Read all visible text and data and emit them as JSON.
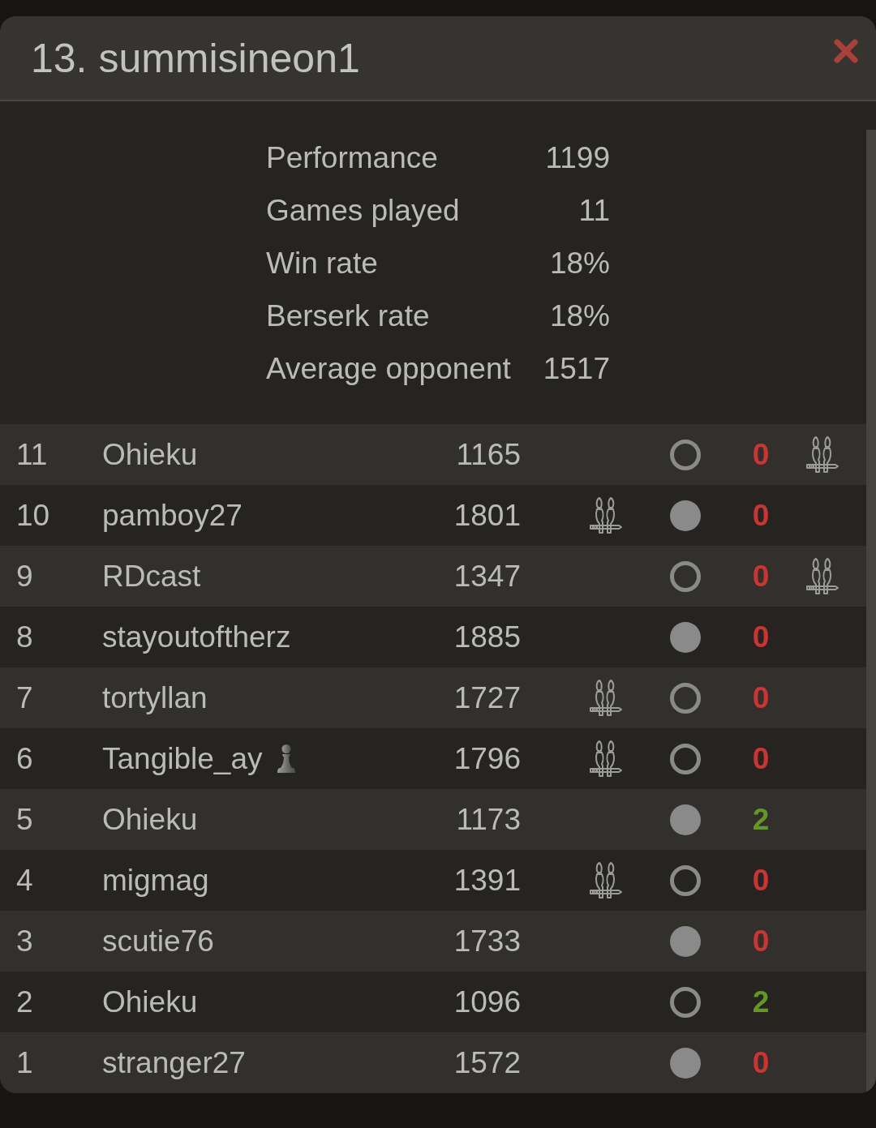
{
  "dialog": {
    "title": "13. summisineon1"
  },
  "stats": [
    {
      "label": "Performance",
      "value": "1199"
    },
    {
      "label": "Games played",
      "value": "11"
    },
    {
      "label": "Win rate",
      "value": "18%"
    },
    {
      "label": "Berserk rate",
      "value": "18%"
    },
    {
      "label": "Average opponent",
      "value": "1517"
    }
  ],
  "games": [
    {
      "round": "11",
      "opponent": "Ohieku",
      "flair": false,
      "rating": "1165",
      "opponent_berserk": false,
      "played_black": false,
      "score": "0",
      "win": false,
      "berserk": true
    },
    {
      "round": "10",
      "opponent": "pamboy27",
      "flair": false,
      "rating": "1801",
      "opponent_berserk": true,
      "played_black": true,
      "score": "0",
      "win": false,
      "berserk": false
    },
    {
      "round": "9",
      "opponent": "RDcast",
      "flair": false,
      "rating": "1347",
      "opponent_berserk": false,
      "played_black": false,
      "score": "0",
      "win": false,
      "berserk": true
    },
    {
      "round": "8",
      "opponent": "stayoutoftherz",
      "flair": false,
      "rating": "1885",
      "opponent_berserk": false,
      "played_black": true,
      "score": "0",
      "win": false,
      "berserk": false
    },
    {
      "round": "7",
      "opponent": "tortyllan",
      "flair": false,
      "rating": "1727",
      "opponent_berserk": true,
      "played_black": false,
      "score": "0",
      "win": false,
      "berserk": false
    },
    {
      "round": "6",
      "opponent": "Tangible_ay",
      "flair": true,
      "rating": "1796",
      "opponent_berserk": true,
      "played_black": false,
      "score": "0",
      "win": false,
      "berserk": false
    },
    {
      "round": "5",
      "opponent": "Ohieku",
      "flair": false,
      "rating": "1173",
      "opponent_berserk": false,
      "played_black": true,
      "score": "2",
      "win": true,
      "berserk": false
    },
    {
      "round": "4",
      "opponent": "migmag",
      "flair": false,
      "rating": "1391",
      "opponent_berserk": true,
      "played_black": false,
      "score": "0",
      "win": false,
      "berserk": false
    },
    {
      "round": "3",
      "opponent": "scutie76",
      "flair": false,
      "rating": "1733",
      "opponent_berserk": false,
      "played_black": true,
      "score": "0",
      "win": false,
      "berserk": false
    },
    {
      "round": "2",
      "opponent": "Ohieku",
      "flair": false,
      "rating": "1096",
      "opponent_berserk": false,
      "played_black": false,
      "score": "2",
      "win": true,
      "berserk": false
    },
    {
      "round": "1",
      "opponent": "stranger27",
      "flair": false,
      "rating": "1572",
      "opponent_berserk": false,
      "played_black": true,
      "score": "0",
      "win": false,
      "berserk": false
    }
  ]
}
